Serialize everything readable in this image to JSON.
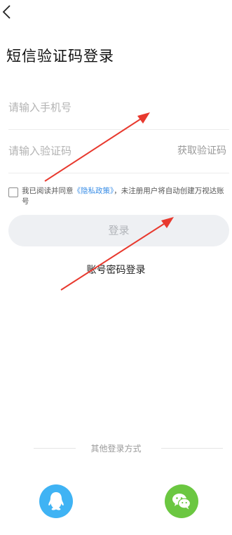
{
  "header": {
    "title": "短信验证码登录"
  },
  "form": {
    "phone_placeholder": "请输入手机号",
    "code_placeholder": "请输入验证码",
    "get_code_label": "获取验证码"
  },
  "agreement": {
    "prefix": "我已阅读并同意",
    "policy_link": "《隐私政策》",
    "suffix": "，未注册用户将自动创建万视达账号"
  },
  "buttons": {
    "login_label": "登录",
    "password_login_label": "账号密码登录"
  },
  "other_login": {
    "label": "其他登录方式",
    "qq_icon": "qq-icon",
    "wechat_icon": "wechat-icon"
  },
  "colors": {
    "accent_link": "#3a8ee6",
    "qq": "#3fb3f4",
    "wechat": "#6bc741",
    "annotation_arrow": "#e8392e"
  }
}
